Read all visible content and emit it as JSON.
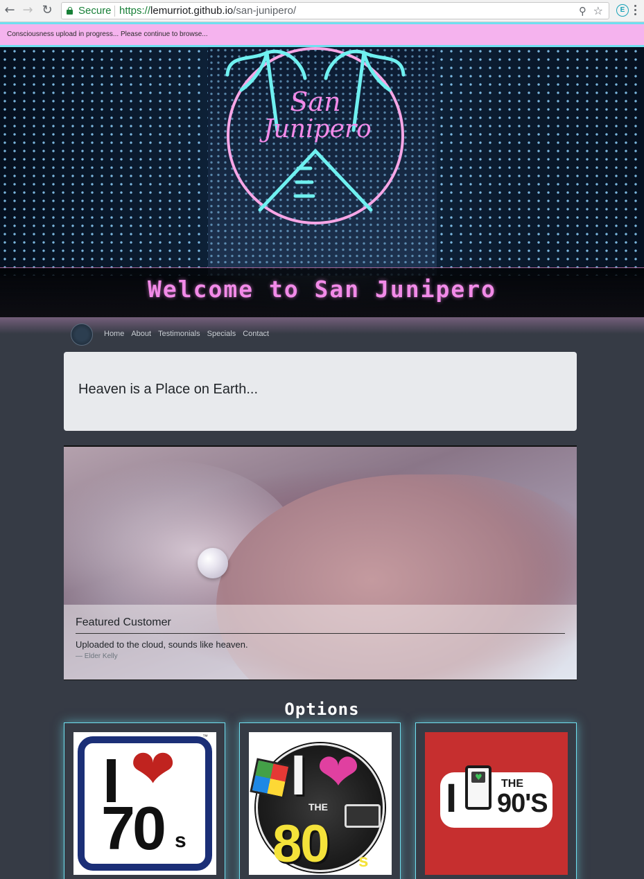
{
  "browser": {
    "secure_label": "Secure",
    "url_scheme": "https://",
    "url_host": "lemurriot.github.io",
    "url_path": "/san-junipero/",
    "extension_letter": "E"
  },
  "notice": {
    "text": "Consciousness upload in progress... Please continue to browse..."
  },
  "hero": {
    "logo_text_line1": "San",
    "logo_text_line2": "Junipero",
    "welcome": "Welcome to San Junipero"
  },
  "nav": {
    "items": [
      {
        "label": "Home"
      },
      {
        "label": "About"
      },
      {
        "label": "Testimonials"
      },
      {
        "label": "Specials"
      },
      {
        "label": "Contact"
      }
    ]
  },
  "jumbotron": {
    "heading": "Heaven is a Place on Earth..."
  },
  "featured": {
    "title": "Featured Customer",
    "quote": "Uploaded to the cloud, sounds like heaven.",
    "cite": "— Elder Kelly"
  },
  "options": {
    "title": "Options",
    "cards": [
      {
        "art_text_i": "I",
        "art_text_decade": "70",
        "art_text_s": "s",
        "art_tm": "™"
      },
      {
        "art_text_i": "I",
        "art_text_the": "THE",
        "art_text_decade": "80",
        "art_text_s": "s"
      },
      {
        "art_text_i": "I",
        "art_text_the": "THE",
        "art_text_decade": "90'S"
      }
    ]
  },
  "colors": {
    "banner_bg": "#f5b3ee",
    "accent_cyan": "#6fe0f0",
    "neon_pink": "#f28ae8",
    "page_bg": "#363b45"
  }
}
